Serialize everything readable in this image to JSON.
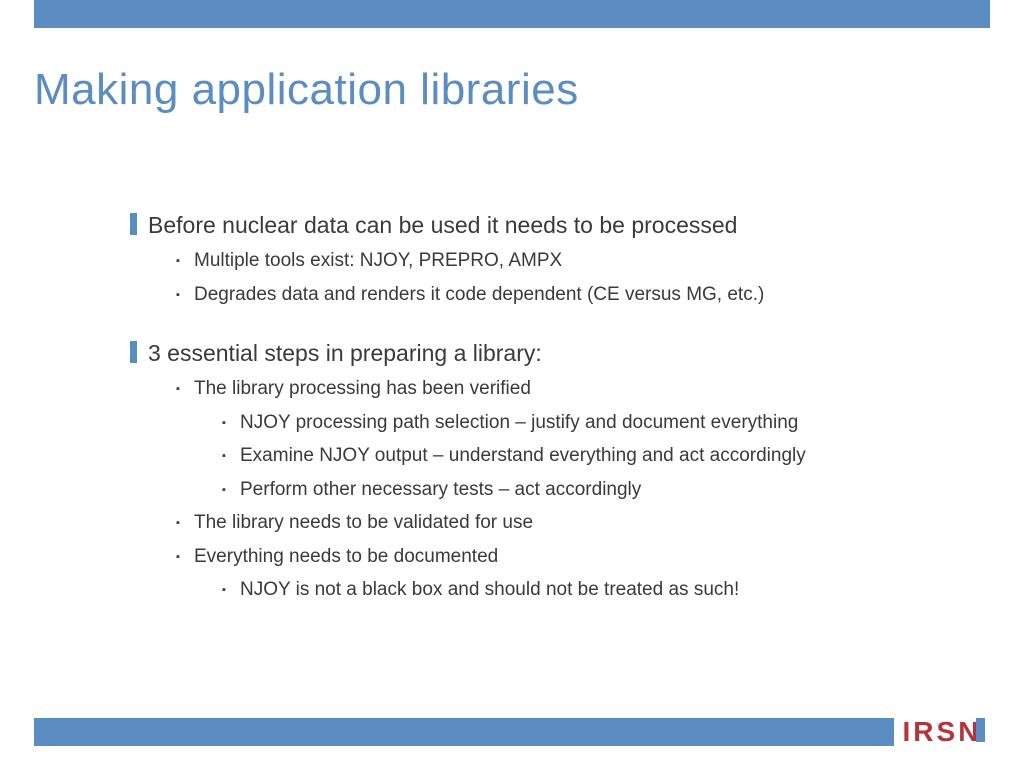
{
  "title": "Making application libraries",
  "sections": [
    {
      "heading": "Before nuclear data can be used it needs to be processed",
      "subs": [
        {
          "text": "Multiple tools exist: NJOY, PREPRO, AMPX"
        },
        {
          "text": "Degrades data and renders it code dependent (CE versus MG, etc.)"
        }
      ]
    },
    {
      "heading": "3 essential steps in preparing a library:",
      "subs": [
        {
          "text": "The library processing has been verified",
          "subs": [
            {
              "text": "NJOY processing path selection – justify and document everything"
            },
            {
              "text": "Examine NJOY output – understand everything and act accordingly"
            },
            {
              "text": "Perform other necessary tests – act accordingly"
            }
          ]
        },
        {
          "text": "The library needs to be validated for use"
        },
        {
          "text": "Everything needs to be documented",
          "subs": [
            {
              "text": "NJOY is not a black box and should not be treated as such!"
            }
          ]
        }
      ]
    }
  ],
  "logo": "IRSN"
}
